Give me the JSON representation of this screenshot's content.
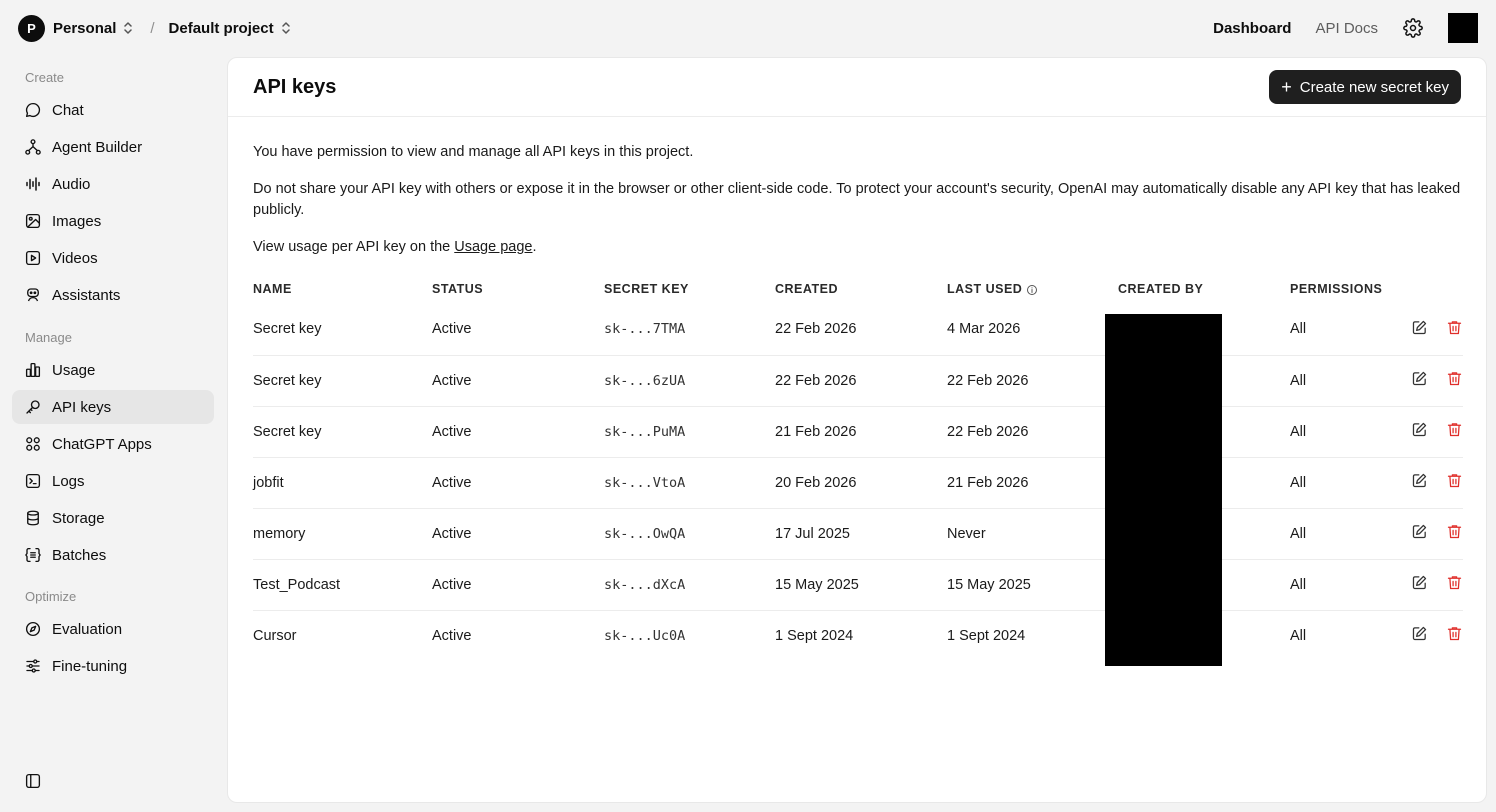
{
  "topbar": {
    "org_initial": "P",
    "org_name": "Personal",
    "separator": "/",
    "project_name": "Default project",
    "nav": [
      {
        "label": "Dashboard",
        "active": true
      },
      {
        "label": "API Docs",
        "active": false
      }
    ]
  },
  "sidebar": {
    "sections": [
      {
        "label": "Create",
        "items": [
          {
            "label": "Chat",
            "icon": "chat-icon"
          },
          {
            "label": "Agent Builder",
            "icon": "agent-builder-icon"
          },
          {
            "label": "Audio",
            "icon": "audio-icon"
          },
          {
            "label": "Images",
            "icon": "images-icon"
          },
          {
            "label": "Videos",
            "icon": "videos-icon"
          },
          {
            "label": "Assistants",
            "icon": "assistants-icon"
          }
        ]
      },
      {
        "label": "Manage",
        "items": [
          {
            "label": "Usage",
            "icon": "usage-icon"
          },
          {
            "label": "API keys",
            "icon": "key-icon",
            "active": true
          },
          {
            "label": "ChatGPT Apps",
            "icon": "apps-icon"
          },
          {
            "label": "Logs",
            "icon": "logs-icon"
          },
          {
            "label": "Storage",
            "icon": "storage-icon"
          },
          {
            "label": "Batches",
            "icon": "batches-icon"
          }
        ]
      },
      {
        "label": "Optimize",
        "items": [
          {
            "label": "Evaluation",
            "icon": "evaluation-icon"
          },
          {
            "label": "Fine-tuning",
            "icon": "fine-tuning-icon"
          }
        ]
      }
    ]
  },
  "main": {
    "title": "API keys",
    "create_button": "Create new secret key",
    "permission_text": "You have permission to view and manage all API keys in this project.",
    "warning_text": "Do not share your API key with others or expose it in the browser or other client-side code. To protect your account's security, OpenAI may automatically disable any API key that has leaked publicly.",
    "usage_prefix": "View usage per API key on the ",
    "usage_link": "Usage page",
    "usage_suffix": ".",
    "table": {
      "headers": [
        "NAME",
        "STATUS",
        "SECRET KEY",
        "CREATED",
        "LAST USED",
        "CREATED BY",
        "PERMISSIONS"
      ],
      "rows": [
        {
          "name": "Secret key",
          "status": "Active",
          "key": "sk-...7TMA",
          "created": "22 Feb 2026",
          "last_used": "4 Mar 2026",
          "permissions": "All"
        },
        {
          "name": "Secret key",
          "status": "Active",
          "key": "sk-...6zUA",
          "created": "22 Feb 2026",
          "last_used": "22 Feb 2026",
          "permissions": "All"
        },
        {
          "name": "Secret key",
          "status": "Active",
          "key": "sk-...PuMA",
          "created": "21 Feb 2026",
          "last_used": "22 Feb 2026",
          "permissions": "All"
        },
        {
          "name": "jobfit",
          "status": "Active",
          "key": "sk-...VtoA",
          "created": "20 Feb 2026",
          "last_used": "21 Feb 2026",
          "permissions": "All"
        },
        {
          "name": "memory",
          "status": "Active",
          "key": "sk-...OwQA",
          "created": "17 Jul 2025",
          "last_used": "Never",
          "permissions": "All"
        },
        {
          "name": "Test_Podcast",
          "status": "Active",
          "key": "sk-...dXcA",
          "created": "15 May 2025",
          "last_used": "15 May 2025",
          "permissions": "All"
        },
        {
          "name": "Cursor",
          "status": "Active",
          "key": "sk-...Uc0A",
          "created": "1 Sept 2024",
          "last_used": "1 Sept 2024",
          "permissions": "All"
        }
      ]
    }
  },
  "colors": {
    "delete": "#e02e2a",
    "accent_dark": "#1f1f1f"
  }
}
